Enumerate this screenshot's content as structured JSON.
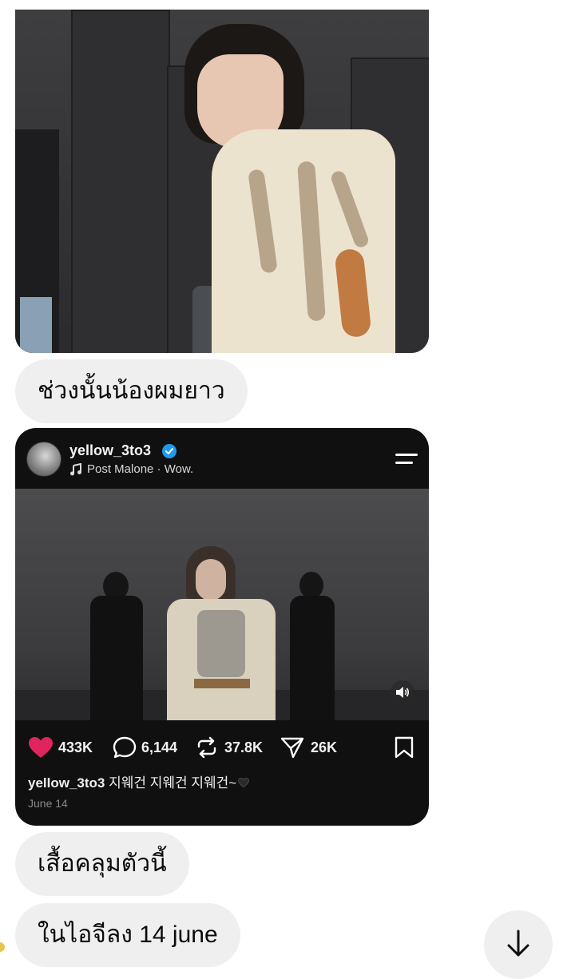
{
  "messages": {
    "bubble1": "ช่วงนั้นน้องผมยาว",
    "bubble2": "เสื้อคลุมตัวนี้",
    "bubble3": "ในไอจีลง 14 june"
  },
  "post": {
    "username": "yellow_3to3",
    "verified": true,
    "music": "Post Malone · Wow.",
    "likes": "433K",
    "comments": "6,144",
    "reposts": "37.8K",
    "shares": "26K",
    "caption_user": "yellow_3to3",
    "caption_text": " 지웨건 지웨건 지웨건~",
    "date": "June 14"
  },
  "colors": {
    "like_heart": "#e0245e",
    "verified_badge": "#1d9bf0",
    "bubble_bg": "#efefef",
    "card_bg": "#101010"
  },
  "icons": {
    "like": "heart-icon",
    "comment": "comment-icon",
    "repost": "repost-icon",
    "share": "share-icon",
    "save": "bookmark-icon",
    "menu": "menu-icon",
    "music": "music-note-icon",
    "sound": "speaker-icon",
    "scroll": "arrow-down-icon"
  }
}
